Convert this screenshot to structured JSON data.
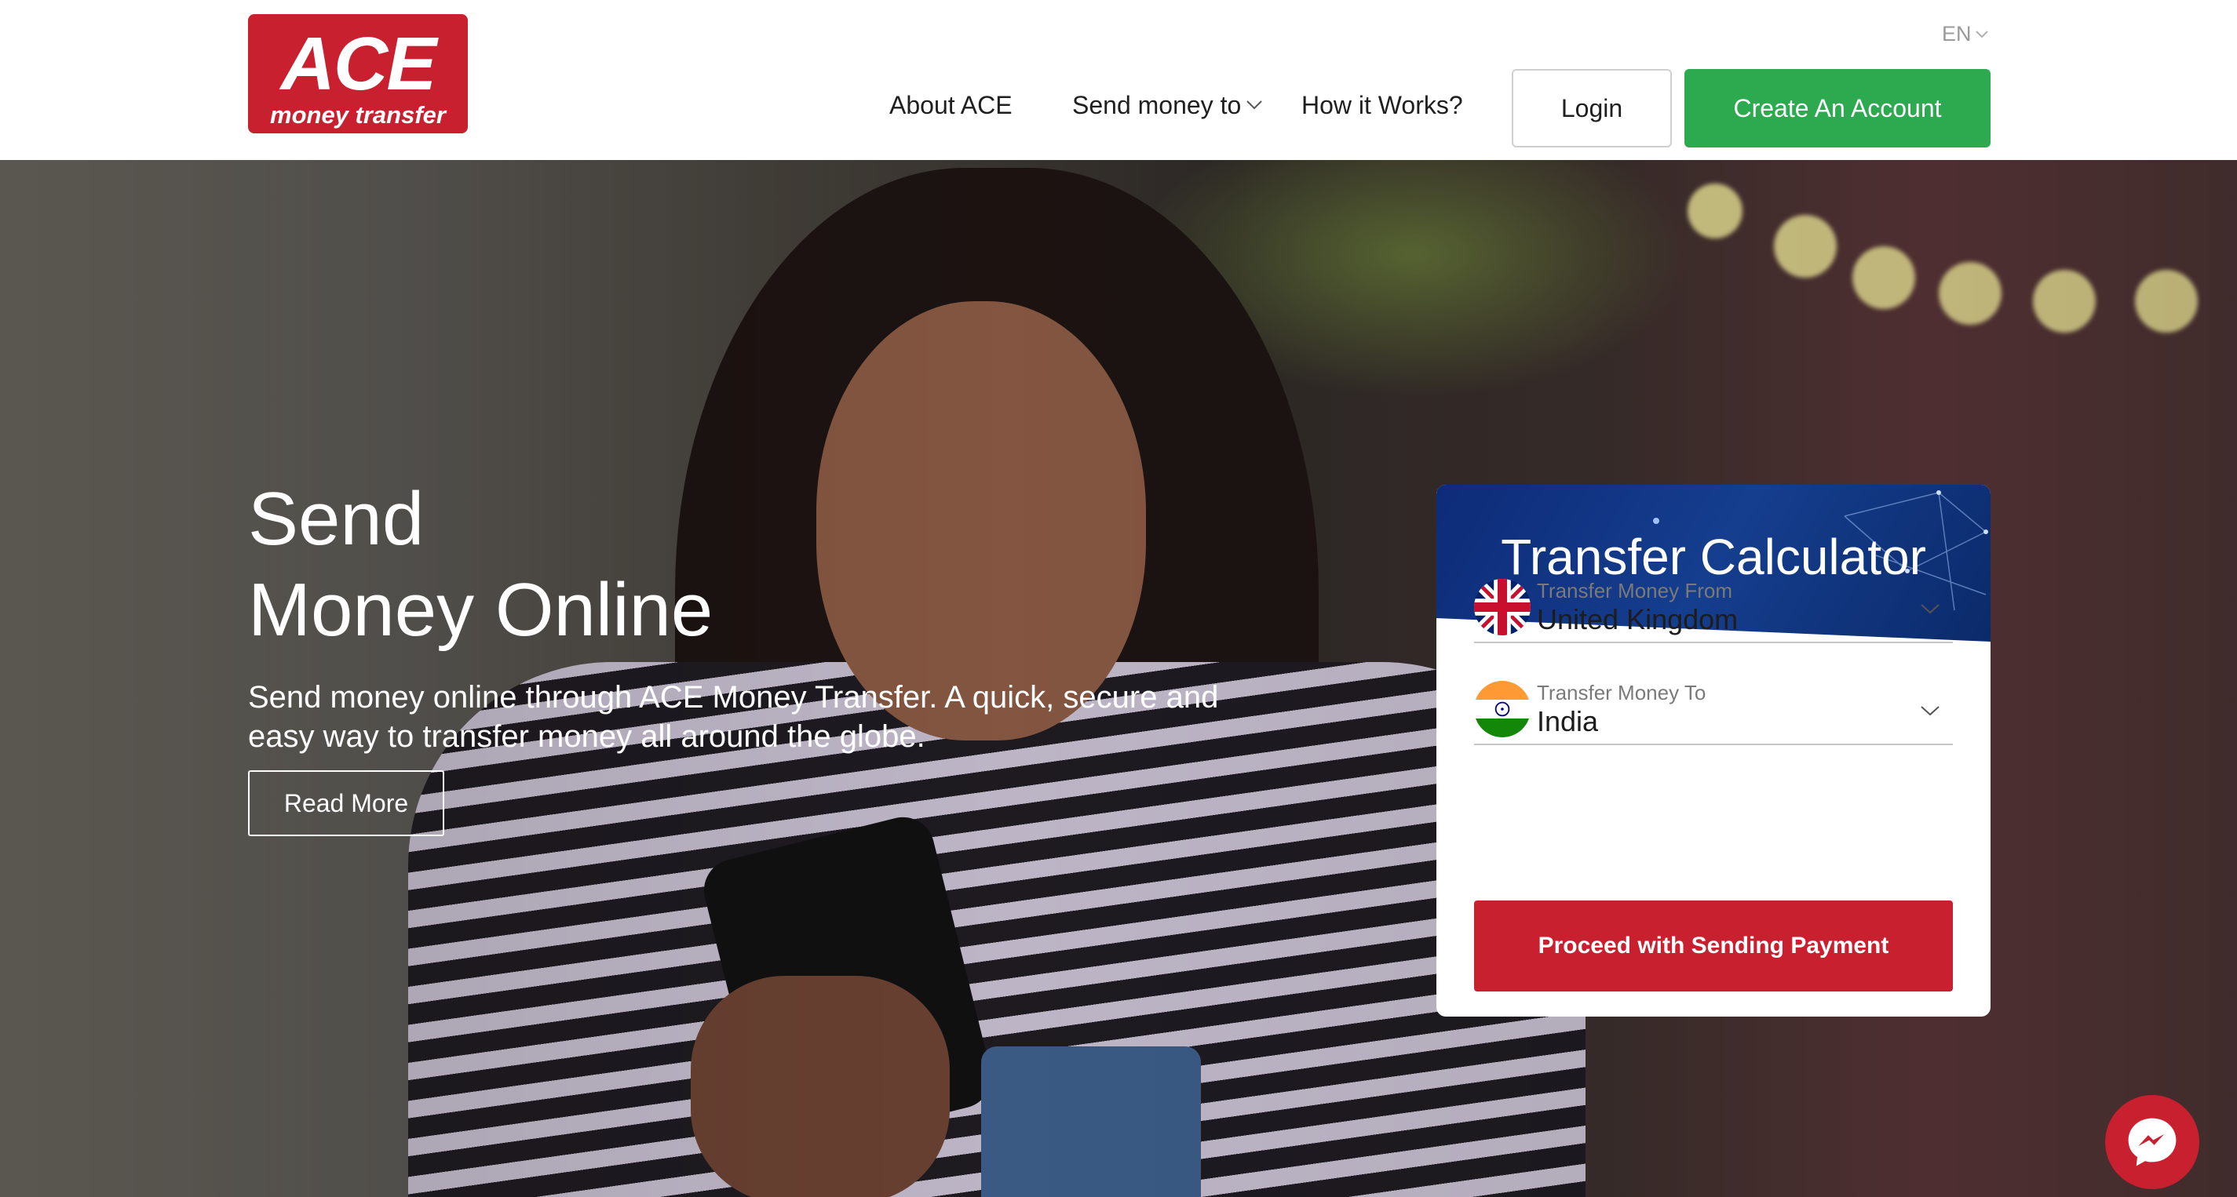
{
  "header": {
    "logo": {
      "brand": "ACE",
      "tagline": "money transfer"
    },
    "language": "EN",
    "nav": {
      "about": "About ACE",
      "send": "Send money to",
      "how": "How it Works?"
    },
    "login_label": "Login",
    "create_label": "Create An Account"
  },
  "hero": {
    "title_line1": "Send",
    "title_line2": "Money Online",
    "subtitle": "Send money online through ACE Money Transfer. A quick, secure and easy way to transfer money all around the globe.",
    "read_more": "Read More"
  },
  "calculator": {
    "title": "Transfer Calculator",
    "from": {
      "label": "Transfer Money From",
      "value": "United Kingdom",
      "flag_icon": "uk-flag-icon"
    },
    "to": {
      "label": "Transfer Money To",
      "value": "India",
      "flag_icon": "india-flag-icon"
    },
    "proceed_label": "Proceed with Sending Payment"
  },
  "colors": {
    "brand_red": "#c8202f",
    "create_green": "#2da94f",
    "calc_header_blue": "#0d2b78"
  }
}
